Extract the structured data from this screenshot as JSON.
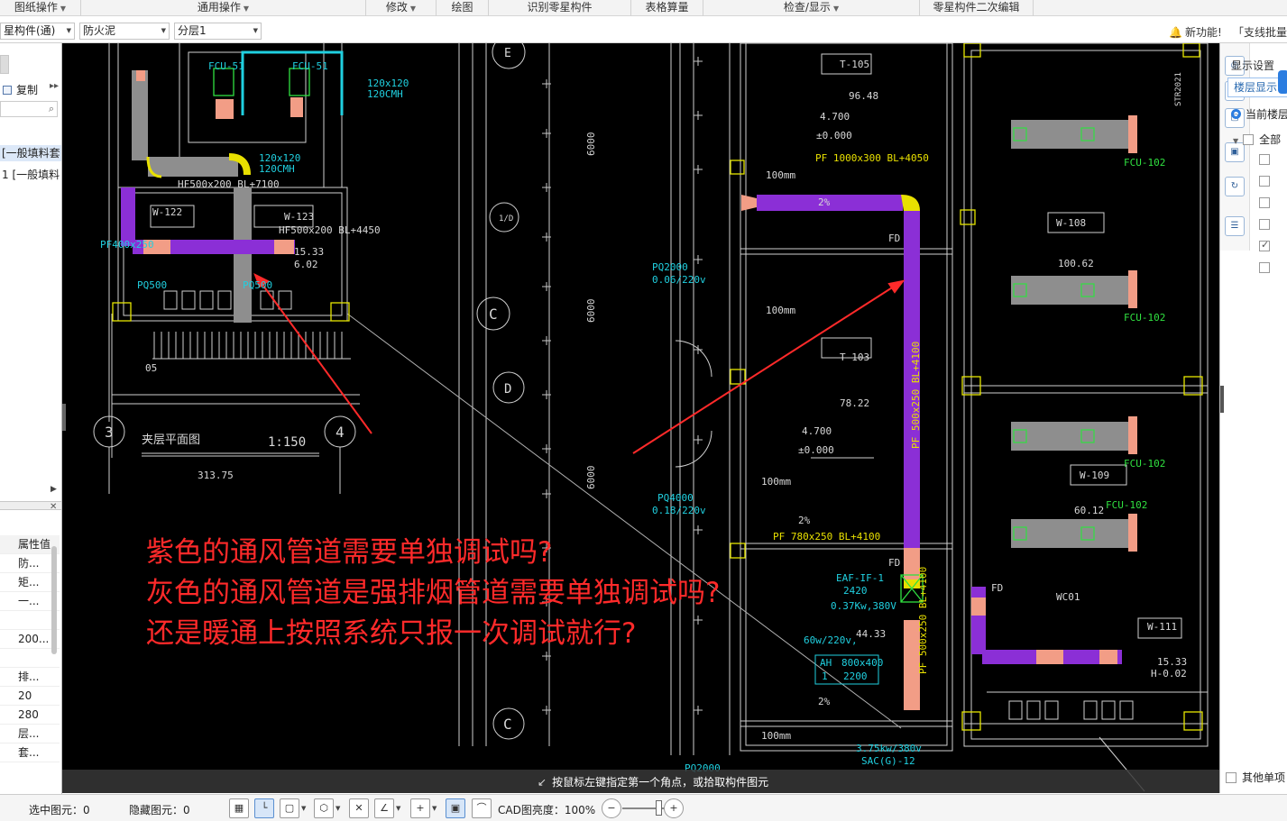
{
  "menu": [
    {
      "label": "图纸操作",
      "caret": true
    },
    {
      "label": "通用操作",
      "caret": true
    },
    {
      "label": "修改",
      "caret": true
    },
    {
      "label": "绘图",
      "caret": false
    },
    {
      "label": "识别零星构件",
      "caret": false
    },
    {
      "label": "表格算量",
      "caret": false
    },
    {
      "label": "检查/显示",
      "caret": true
    },
    {
      "label": "零星构件二次编辑",
      "caret": false
    }
  ],
  "toolbar": {
    "component_type": "星构件(通)",
    "material": "防火泥",
    "layer": "分层1",
    "new_feature": "新功能!",
    "batch": "「支线批量设"
  },
  "left_panel": {
    "copy": "复制",
    "tree_items": [
      "[一般填料套",
      "1 [一般填料"
    ],
    "props": [
      "属性值",
      "防...",
      "矩...",
      "一...",
      "",
      "200...",
      "",
      "排...",
      "20",
      "280",
      "层...",
      "套..."
    ]
  },
  "cad": {
    "question_lines": [
      "紫色的通风管道需要单独调试吗?",
      "灰色的通风管道是强排烟管道需要单独调试吗?",
      "还是暖通上按照系统只报一次调试就行?"
    ],
    "command_prompt": "按鼠标左键指定第一个角点，或拾取构件图元",
    "labels": {
      "fcu51a": "FCU-51",
      "fcu51b": "FCU-51",
      "hf1": "HF500x200 BL+7100",
      "hf2": "HF500x200 BL+4450",
      "r120a": "120x120",
      "r120b": "120CMH",
      "r120c": "120x120",
      "r120d": "120CMH",
      "w122": "W-122",
      "w123": "W-123",
      "pf400": "PF400x250",
      "pq500": "PQ500",
      "pq500b": "PQ500",
      "v1533": "15.33",
      "v602": "6.02",
      "num05": "05",
      "num3": "3",
      "num4": "4",
      "plan_title": "夹层平面图",
      "plan_scale": "1:150",
      "plan_elev": "313.75",
      "t105": "T-105",
      "v9648": "96.48",
      "t103": "T-103",
      "v7822": "78.22",
      "v4700a": "4.700",
      "v000a": "±0.000",
      "v4700b": "4.700",
      "v000b": "±0.000",
      "pf1": "PF 1000x300 BL+4050",
      "pf2": "PF 500x250 BL+4100",
      "pf3": "PF 780x250 BL+4100",
      "pf4": "PF 500x250 BL+4100",
      "fd1": "FD",
      "fd2": "FD",
      "fd3": "FD",
      "fd4": "FD",
      "pq2000": "PQ2000",
      "pq2000v": "0.06/220v",
      "pq4000": "PQ4000",
      "pq4000v": "0.18/220v",
      "pq2000b": "PQ2000",
      "mm100a": "100mm",
      "mm100b": "100mm",
      "mm100c": "100mm",
      "mm100d": "100mm",
      "pct2a": "2%",
      "pct2b": "2%",
      "pct2c": "2%",
      "pct2d": "2%",
      "eaf": "EAF-IF-1",
      "eaf1": "2420",
      "eaf2": "0.37Kw,380V",
      "eaf3": "60w/220v,",
      "ah": "AH",
      "ah1": "800x400",
      "ah2": "1",
      "ah3": "2200",
      "v4433": "44.33",
      "kw375": "3.75kw/380v",
      "sac": "SAC(G)-12",
      "w108": "W-108",
      "v10062": "100.62",
      "w109": "W-109",
      "w111": "W-111",
      "wc01": "WC01",
      "v6012": "60.12",
      "v1533b": "15.33",
      "h002": "H-0.02",
      "fcu102a": "FCU-102",
      "fcu102b": "FCU-102",
      "fcu102c": "FCU-102",
      "fcu102d": "FCU-102",
      "grid_e": "E",
      "grid_c": "C",
      "grid_d": "D",
      "grid_c2": "C",
      "grid_1d": "1/D",
      "dim6000a": "6000",
      "dim6000b": "6000",
      "dim6000c": "6000",
      "side_code": "STR2021"
    }
  },
  "right_panel": {
    "title": "显示设置",
    "tab": "楼层显示",
    "radio": "当前楼层",
    "all": "全部",
    "items": [
      "",
      "",
      "",
      "",
      "",
      ""
    ],
    "other": "其他单项"
  },
  "status": {
    "selected": "选中图元：0",
    "hidden": "隐藏图元：0",
    "cad_brightness": "CAD图亮度：100%"
  }
}
